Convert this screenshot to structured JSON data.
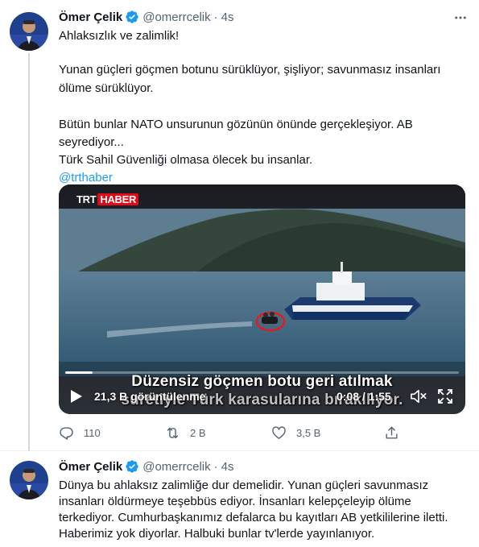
{
  "tweets": [
    {
      "author_name": "Ömer Çelik",
      "handle": "@omerrcelik",
      "dot": "·",
      "time": "4s",
      "text_lines": [
        "Ahlaksızlık ve zalimlik!",
        "",
        "Yunan güçleri göçmen botunu sürüklüyor, şişliyor; savunmasız insanları",
        "ölüme sürüklüyor.",
        "",
        "Bütün bunlar NATO unsurunun gözünün önünde gerçekleşiyor. AB",
        "seyrediyor...",
        "Türk Sahil Güvenliği olmasa ölecek bu insanlar."
      ],
      "mention": "@trthaber",
      "media": {
        "logo_trt": "TRT",
        "logo_haber": "HABER",
        "subtitle_line1": "Düzensiz göçmen botu geri atılmak",
        "subtitle_line2": "suretiyle Türk karasularına bırakılıyor.",
        "views": "21,3 B görüntülenme",
        "timecode": "0:08 / 1:55",
        "progress_fraction": 0.07
      },
      "actions": {
        "reply_count": "110",
        "retweet_count": "2 B",
        "like_count": "3,5 B"
      }
    },
    {
      "author_name": "Ömer Çelik",
      "handle": "@omerrcelik",
      "dot": "·",
      "time": "4s",
      "text_lines": [
        "Dünya bu ahlaksız zalimliğe dur demelidir. Yunan güçleri savunmasız",
        "insanları öldürmeye teşebbüs ediyor. İnsanları kelepçeleyip ölüme",
        "terkediyor. Cumhurbaşkanımız defalarca bu kayıtları AB yetkililerine iletti.",
        "Haberimiz yok diyorlar. Halbuki bunlar tv'lerde yayınlanıyor."
      ]
    }
  ],
  "colors": {
    "accent": "#1d9bf0",
    "secondary_text": "#536471",
    "trt_red": "#e30a17"
  },
  "icons": {
    "verified": "verified-badge-icon",
    "more": "more-dots-icon",
    "reply": "reply-icon",
    "retweet": "retweet-icon",
    "like": "heart-icon",
    "share": "share-icon",
    "play": "play-icon",
    "mute": "muted-speaker-icon",
    "fullscreen": "fullscreen-icon"
  }
}
